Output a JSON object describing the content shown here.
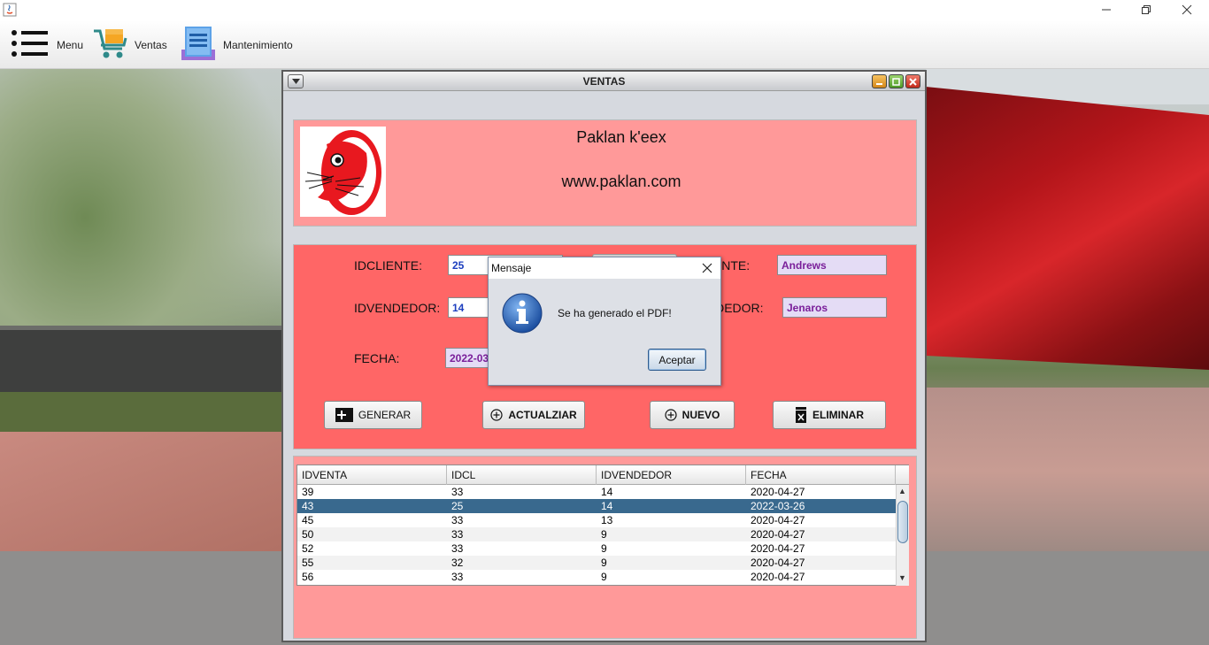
{
  "menubar": {
    "menu_label": "Menu",
    "ventas_label": "Ventas",
    "mantenimiento_label": "Mantenimiento"
  },
  "window": {
    "title": "VENTAS"
  },
  "header": {
    "brand_name": "Paklan k'eex",
    "brand_url": "www.paklan.com"
  },
  "form": {
    "idcliente_label": "IDCLIENTE:",
    "idcliente_value": "25",
    "cliente_label_partial": "IENTE:",
    "cliente_value": "Andrews",
    "idvendedor_label": "IDVENDEDOR:",
    "idvendedor_value": "14",
    "vendedor_label_partial": "NDEDOR:",
    "vendedor_value": "Jenaros",
    "fecha_label": "FECHA:",
    "fecha_value": "2022-03"
  },
  "buttons": {
    "generar": "GENERAR",
    "actualizar": "ACTUALZIAR",
    "nuevo": "NUEVO",
    "eliminar": "ELIMINAR"
  },
  "table": {
    "columns": [
      "IDVENTA",
      "IDCL",
      "IDVENDEDOR",
      "FECHA"
    ],
    "rows": [
      [
        "39",
        "33",
        "14",
        "2020-04-27"
      ],
      [
        "43",
        "25",
        "14",
        "2022-03-26"
      ],
      [
        "45",
        "33",
        "13",
        "2020-04-27"
      ],
      [
        "50",
        "33",
        "9",
        "2020-04-27"
      ],
      [
        "52",
        "33",
        "9",
        "2020-04-27"
      ],
      [
        "55",
        "32",
        "9",
        "2020-04-27"
      ],
      [
        "56",
        "33",
        "9",
        "2020-04-27"
      ]
    ],
    "selected_row_index": 1
  },
  "dialog": {
    "title": "Mensaje",
    "message": "Se ha generado el PDF!",
    "ok_label": "Aceptar",
    "icon": "info-icon"
  },
  "colors": {
    "header_panel": "#ff9999",
    "form_panel": "#ff6666",
    "selected_row": "#39698e",
    "accent_blue": "#1d3fbf",
    "accent_purple": "#7a1f9a"
  }
}
